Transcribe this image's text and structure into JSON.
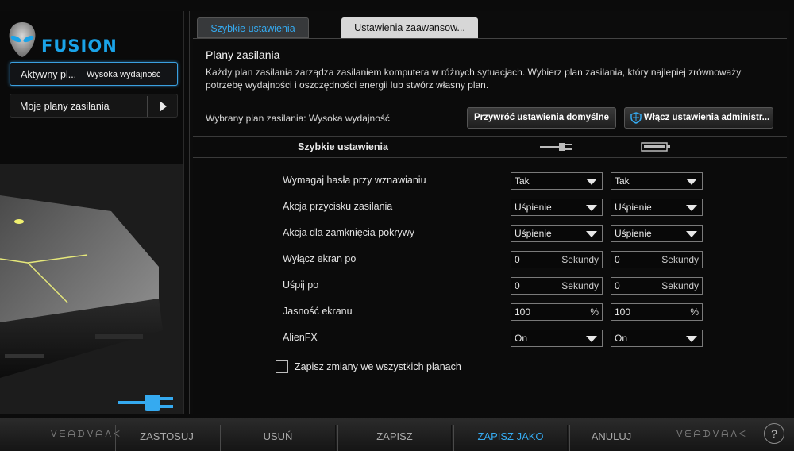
{
  "sidebar": {
    "logo_text": "FUSION",
    "active_plan_label": "Aktywny pl...",
    "active_plan_value": "Wysoka wydajność",
    "my_plans_label": "Moje plany zasilania"
  },
  "tabs": {
    "quick": "Szybkie ustawienia",
    "advanced": "Ustawienia zaawansow..."
  },
  "plans": {
    "title": "Plany zasilania",
    "description": "Każdy plan zasilania zarządza zasilaniem komputera w różnych sytuacjach.  Wybierz plan zasilania, który najlepiej zrównoważy potrzebę wydajności i oszczędności energii lub stwórz własny plan.",
    "selected": "Wybrany plan zasilania: Wysoka wydajność",
    "restore_button": "Przywróć ustawienia domyślne",
    "admin_button": "Włącz ustawienia administr..."
  },
  "table": {
    "header": "Szybkie ustawienia",
    "rows": [
      {
        "label": "Wymagaj hasła przy wznawianiu",
        "ac": "Tak",
        "batt": "Tak",
        "unit": ""
      },
      {
        "label": "Akcja przycisku zasilania",
        "ac": "Uśpienie",
        "batt": "Uśpienie",
        "unit": ""
      },
      {
        "label": "Akcja dla zamknięcia pokrywy",
        "ac": "Uśpienie",
        "batt": "Uśpienie",
        "unit": ""
      },
      {
        "label": "Wyłącz ekran po",
        "ac": "0",
        "batt": "0",
        "unit": "Sekundy"
      },
      {
        "label": "Uśpij po",
        "ac": "0",
        "batt": "0",
        "unit": "Sekundy"
      },
      {
        "label": "Jasność ekranu",
        "ac": "100",
        "batt": "100",
        "unit": "%"
      },
      {
        "label": "AlienFX",
        "ac": "On",
        "batt": "On",
        "unit": ""
      }
    ],
    "save_all_label": "Zapisz zmiany we wszystkich planach"
  },
  "bottom": {
    "deco_left": "ᐯᗴᗩᗪᐯᗩᐱᐸ",
    "deco_right": "ᐯᗴᗩᗪᐯᗩᐱᐸ",
    "apply": "ZASTOSUJ",
    "delete": "USUŃ",
    "save": "ZAPISZ",
    "save_as": "ZAPISZ JAKO",
    "cancel": "ANULUJ",
    "help": "?"
  },
  "colors": {
    "accent": "#35aaf0",
    "panel": "#0b0b0b"
  }
}
